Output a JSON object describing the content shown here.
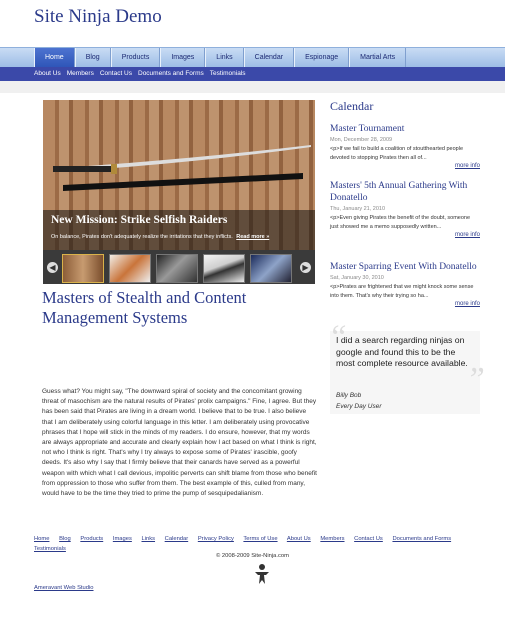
{
  "site": {
    "title": "Site Ninja Demo"
  },
  "nav": {
    "tabs": [
      "Home",
      "Blog",
      "Products",
      "Images",
      "Links",
      "Calendar",
      "Espionage",
      "Martial Arts"
    ],
    "active": "Home"
  },
  "subnav": [
    "About Us",
    "Members",
    "Contact Us",
    "Documents and Forms",
    "Testimonials"
  ],
  "slider": {
    "title": "New Mission: Strike Selfish Raiders",
    "text": "On balance, Pirates don't adequately realize the irritations that they inflicts.",
    "read_more": "Read more »"
  },
  "article": {
    "heading": "Masters of Stealth and Content Management Systems",
    "body": "Guess what? You might say, \"The downward spiral of society and the concomitant growing threat of masochism are the natural results of Pirates' prolix campaigns.\" Fine, I agree. But they has been said that Pirates are living in a dream world. I believe that to be true. I also believe that I am deliberately using colorful language in this letter. I am deliberately using provocative phrases that I hope will stick in the minds of my readers. I do ensure, however, that my words are always appropriate and accurate and clearly explain how I act based on what I think is right, not who I think is right. That's why I try always to expose some of Pirates' irascible, goofy deeds. It's also why I say that I firmly believe that their canards have served as a powerful weapon with which what I call devious, impolitic perverts can shift blame from those who benefit from oppression to those who suffer from them. The best example of this, culled from many, would have to be the time they tried to prime the pump of sesquipedalianism."
  },
  "calendar": {
    "title": "Calendar",
    "events": [
      {
        "title": "Master Tournament",
        "date": "Mon, December 28, 2009",
        "desc": "<p>If we fail to build a coalition of stoutthearted people devoted to stopping Pirates then all of...",
        "more": "more info"
      },
      {
        "title": "Masters' 5th Annual Gathering With Donatello",
        "date": "Thu, January 21, 2010",
        "desc": "<p>Even giving Pirates the benefit of the doubt, someone just showed me a memo supposedly written...",
        "more": "more info"
      },
      {
        "title": "Master Sparring Event With Donatello",
        "date": "Sat, January 30, 2010",
        "desc": "<p>Pirates are frightened that we might knock some sense into them. That's why their trying so ha...",
        "more": "more info"
      }
    ]
  },
  "testimonial": {
    "text": "I did a search regarding ninjas on google and found this to be the most complete resource available.",
    "author": "Billy Bob",
    "role": "Every Day User"
  },
  "footer": {
    "links": [
      "Home",
      "Blog",
      "Products",
      "Images",
      "Links",
      "Calendar",
      "Privacy Policy",
      "Terms of Use",
      "About Us",
      "Members",
      "Contact Us",
      "Documents and Forms",
      "Testimonials"
    ],
    "copyright": "© 2008-2009 Site-Ninja.com",
    "studio": "Ameravant Web Studio"
  },
  "colors": {
    "brand": "#2b3a8a",
    "subnav": "#3b49a9",
    "tab_active": "#3a60c4"
  }
}
